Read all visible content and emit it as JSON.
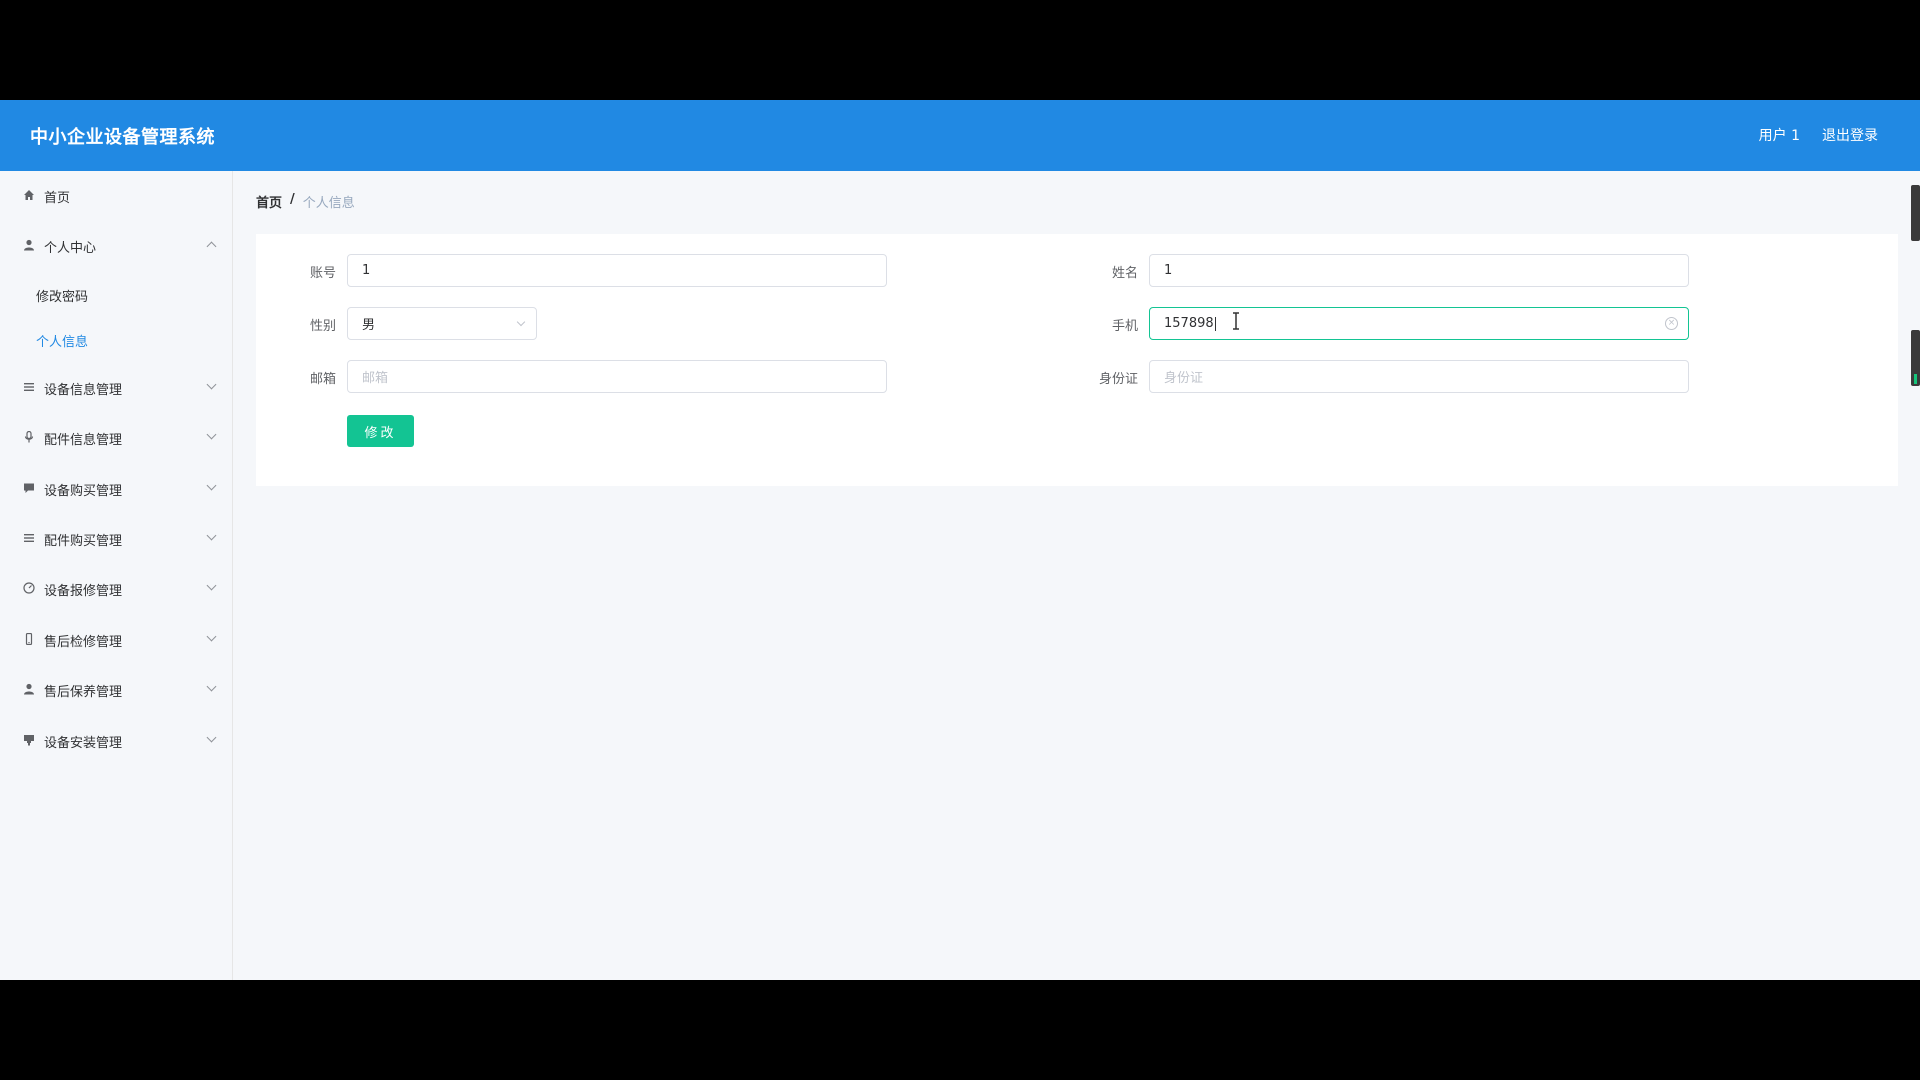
{
  "header": {
    "title": "中小企业设备管理系统",
    "user": "用户 1",
    "logout": "退出登录"
  },
  "sidebar": {
    "items": [
      {
        "label": "首页",
        "icon": "home-icon"
      },
      {
        "label": "个人中心",
        "icon": "user-icon",
        "expanded": true,
        "children": [
          {
            "label": "修改密码"
          },
          {
            "label": "个人信息",
            "active": true
          }
        ]
      },
      {
        "label": "设备信息管理",
        "icon": "list-icon"
      },
      {
        "label": "配件信息管理",
        "icon": "microphone-icon"
      },
      {
        "label": "设备购买管理",
        "icon": "chat-icon"
      },
      {
        "label": "配件购买管理",
        "icon": "list-icon"
      },
      {
        "label": "设备报修管理",
        "icon": "gauge-icon"
      },
      {
        "label": "售后检修管理",
        "icon": "mobile-icon"
      },
      {
        "label": "售后保养管理",
        "icon": "person-icon"
      },
      {
        "label": "设备安装管理",
        "icon": "cup-icon"
      }
    ]
  },
  "breadcrumb": {
    "home": "首页",
    "separator": "/",
    "current": "个人信息"
  },
  "form": {
    "account_label": "账号",
    "account_value": "1",
    "name_label": "姓名",
    "name_value": "1",
    "gender_label": "性别",
    "gender_value": "男",
    "phone_label": "手机",
    "phone_value": "157898",
    "email_label": "邮箱",
    "email_placeholder": "邮箱",
    "idcard_label": "身份证",
    "idcard_placeholder": "身份证",
    "submit_label": "修改"
  },
  "colors": {
    "header_bg": "#2189e3",
    "accent": "#13c493",
    "active_menu": "#2189e3"
  }
}
